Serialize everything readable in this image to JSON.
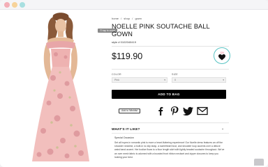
{
  "window": {
    "controls": [
      "close",
      "minimize",
      "maximize"
    ]
  },
  "gallery": {
    "zoom_label": "ⓠ tap to zoom",
    "image_alt": "model in pink off-shoulder soutache ball gown"
  },
  "breadcrumb": [
    "home",
    "/",
    "shop",
    "/",
    "gown"
  ],
  "product": {
    "title": "NOELLE PINK SOUTACHE BALL GOWN",
    "style_number": "style # 0102040419",
    "price": "$119.90",
    "favorites_count": "124"
  },
  "options": {
    "color_label": "COLOR",
    "color_value": "Pink",
    "size_label": "SIZE",
    "size_value": "0"
  },
  "actions": {
    "add_to_bag": "ADD TO BAG",
    "wishlist": "Add to Wishlist"
  },
  "share": [
    "facebook-icon",
    "pinterest-icon",
    "twitter-icon",
    "email-icon"
  ],
  "accordion": {
    "title": "WHAT'S IT LIKE?",
    "subtitle": "Special Occasion",
    "description": "Set all hopes in romantic pink is more a heart-fluttering experience! Our Noelle dress features an off the shoulder neckline, a built-in no slip strap, a sweetheart bust, and shoulder loop accents over a deluxe waist band accent. Her bodice flows to a floor length skirt with lightly beaded soutache throughout. We've an over mesh fabric is adorned with a boosted front ribbon neckset and zipper closures to keep you looking your best."
  },
  "colors": {
    "accent_teal": "#57c3c3",
    "heart_pink": "#e2536a",
    "button_black": "#000000"
  }
}
